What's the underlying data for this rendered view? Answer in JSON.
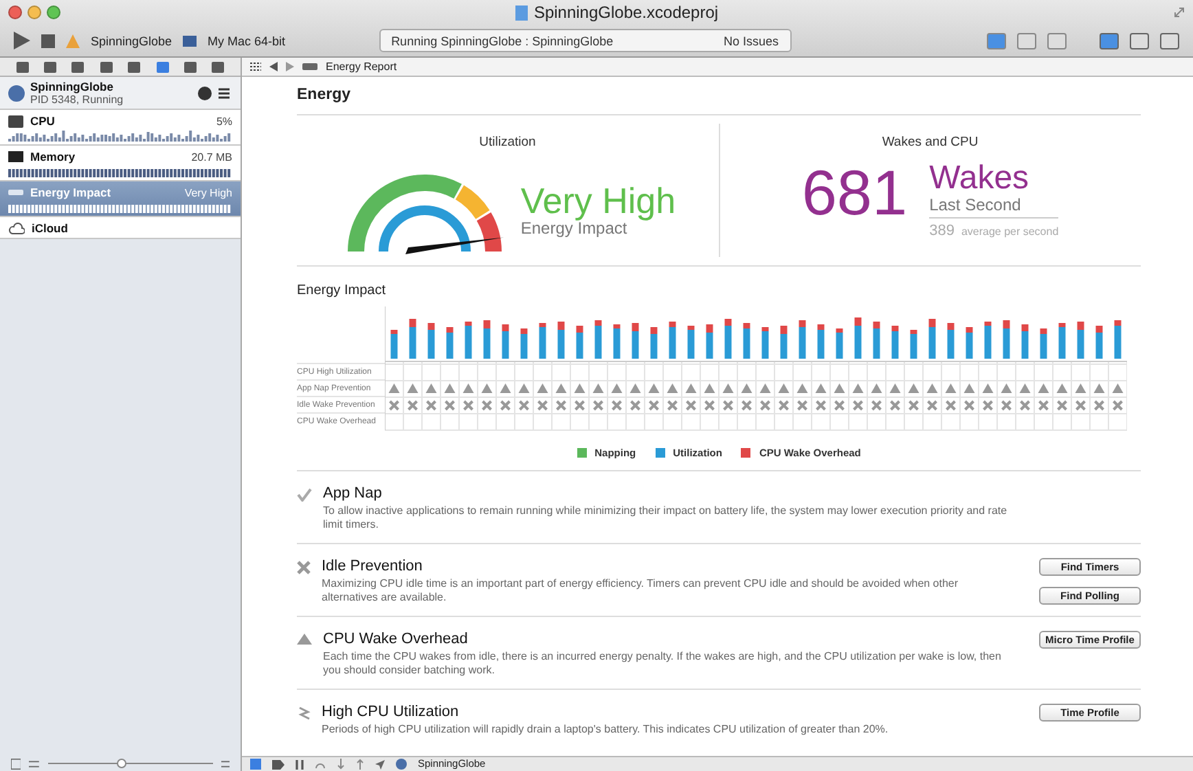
{
  "window": {
    "title": "SpinningGlobe.xcodeproj"
  },
  "toolbar": {
    "scheme": "SpinningGlobe",
    "destination": "My Mac 64-bit",
    "status": "Running SpinningGlobe : SpinningGlobe",
    "issues": "No Issues",
    "editor_modes": [
      {
        "selected": true
      },
      {
        "selected": false
      },
      {
        "selected": false
      }
    ],
    "view_toggles": [
      {
        "on": true
      },
      {
        "on": false
      },
      {
        "on": false
      }
    ]
  },
  "navigator_tabs": [
    {
      "selected": false
    },
    {
      "selected": false
    },
    {
      "selected": false
    },
    {
      "selected": false
    },
    {
      "selected": false
    },
    {
      "selected": true
    },
    {
      "selected": false
    },
    {
      "selected": false
    }
  ],
  "jump_bar": {
    "item": "Energy Report"
  },
  "sidebar": {
    "process": {
      "name": "SpinningGlobe",
      "detail": "PID 5348, Running"
    },
    "items": [
      {
        "kind": "cpu",
        "label": "CPU",
        "value": "5%",
        "selected": false
      },
      {
        "kind": "memory",
        "label": "Memory",
        "value": "20.7 MB",
        "selected": false
      },
      {
        "kind": "energy",
        "label": "Energy Impact",
        "value": "Very High",
        "selected": true
      },
      {
        "kind": "icloud",
        "label": "iCloud",
        "selected": false
      }
    ],
    "zoom_slider": {
      "level": 0.45
    }
  },
  "report": {
    "title": "Energy",
    "utilization": {
      "title": "Utilization",
      "rating": "Very High",
      "caption": "Energy Impact"
    },
    "wakes": {
      "title": "Wakes and CPU",
      "count": "681",
      "unit": "Wakes",
      "period": "Last Second",
      "average": "389",
      "average_label": "average per second"
    },
    "impact": {
      "title": "Energy Impact",
      "rows": [
        {
          "label": "CPU High Utilization",
          "kind": "none"
        },
        {
          "label": "App Nap Prevention",
          "kind": "triangle"
        },
        {
          "label": "Idle Wake Prevention",
          "kind": "cross"
        },
        {
          "label": "CPU Wake Overhead",
          "kind": "none"
        }
      ],
      "legend": [
        {
          "label": "Napping",
          "color": "#5cb85c"
        },
        {
          "label": "Utilization",
          "color": "#2a9bd6"
        },
        {
          "label": "CPU Wake Overhead",
          "color": "#e04848"
        }
      ]
    },
    "issues": [
      {
        "kind": "check",
        "title": "App Nap",
        "text": "To allow inactive applications to remain running while minimizing their impact on battery life, the system may lower execution priority and rate limit timers."
      },
      {
        "kind": "cross",
        "title": "Idle Prevention",
        "text": "Maximizing CPU idle time is an important part of energy efficiency.  Timers can prevent CPU idle and should be avoided when other alternatives are available.",
        "buttons": [
          "Find Timers",
          "Find Polling"
        ]
      },
      {
        "kind": "triangle",
        "title": "CPU Wake Overhead",
        "text": "Each time the CPU wakes from idle, there is an incurred energy penalty.  If the wakes are high, and the CPU utilization per wake is low, then you should consider batching work.",
        "buttons": [
          "Micro Time Profile"
        ]
      },
      {
        "kind": "bolt",
        "title": "High CPU Utilization",
        "text": "Periods of high CPU utilization will rapidly drain a laptop's battery. This indicates CPU utilization of greater than 20%.",
        "buttons": [
          "Time Profile"
        ]
      }
    ]
  },
  "debug_bar": {
    "target": "SpinningGlobe"
  }
}
